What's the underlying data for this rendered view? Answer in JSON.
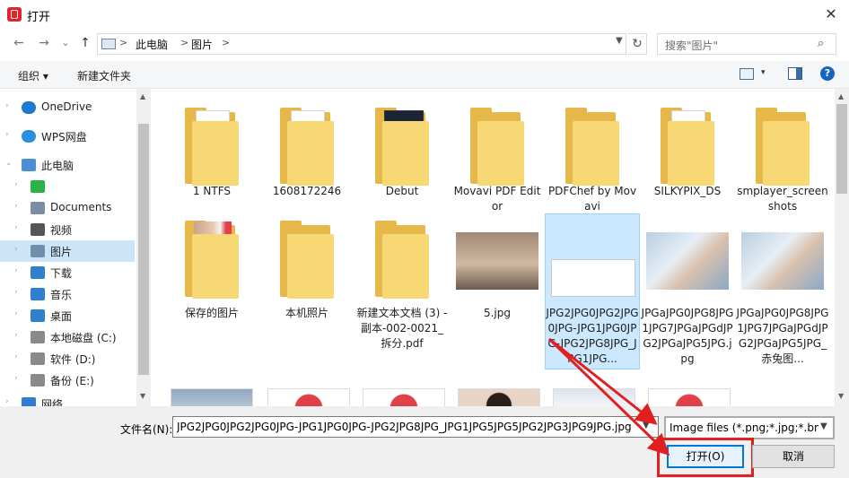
{
  "window": {
    "title": "打开",
    "close": "✕"
  },
  "nav": {
    "back": "←",
    "forward": "→",
    "recent": "⌄",
    "up": "↑"
  },
  "address": {
    "crumbs": [
      "此电脑",
      "图片"
    ],
    "separator": ">",
    "refresh": "↻"
  },
  "search": {
    "placeholder": "搜索\"图片\""
  },
  "toolbar": {
    "organize": "组织 ▾",
    "new_folder": "新建文件夹",
    "view_drop": "▾",
    "help": "?"
  },
  "sidebar": {
    "items": [
      {
        "label": "OneDrive",
        "icon": "cloud-icon"
      },
      {
        "label": "WPS网盘",
        "icon": "wps-cloud-icon"
      },
      {
        "label": "此电脑",
        "icon": "computer-icon"
      },
      {
        "label": "",
        "icon": "wechat-icon"
      },
      {
        "label": "Documents",
        "icon": "documents-icon"
      },
      {
        "label": "视频",
        "icon": "video-icon"
      },
      {
        "label": "图片",
        "icon": "pictures-icon"
      },
      {
        "label": "下载",
        "icon": "download-icon"
      },
      {
        "label": "音乐",
        "icon": "music-icon"
      },
      {
        "label": "桌面",
        "icon": "desktop-icon"
      },
      {
        "label": "本地磁盘 (C:)",
        "icon": "drive-icon"
      },
      {
        "label": "软件 (D:)",
        "icon": "drive-icon"
      },
      {
        "label": "备份 (E:)",
        "icon": "drive-icon"
      },
      {
        "label": "网络",
        "icon": "network-icon"
      }
    ]
  },
  "files": [
    {
      "label": "1 NTFS",
      "type": "folder"
    },
    {
      "label": "1608172246",
      "type": "folder"
    },
    {
      "label": "Debut",
      "type": "folder"
    },
    {
      "label": "Movavi PDF Editor",
      "type": "folder"
    },
    {
      "label": "PDFChef by Movavi",
      "type": "folder"
    },
    {
      "label": "SILKYPIX_DS",
      "type": "folder"
    },
    {
      "label": "smplayer_screenshots",
      "type": "folder"
    },
    {
      "label": "保存的图片",
      "type": "folder"
    },
    {
      "label": "本机照片",
      "type": "folder"
    },
    {
      "label": "新建文本文档 (3) - 副本-002-0021_拆分.pdf",
      "type": "folder"
    },
    {
      "label": "5.jpg",
      "type": "image"
    },
    {
      "label": "JPG2JPG0JPG2JPG0JPG-JPG1JPG0JPG-JPG2JPG8JPG_JPG1JPG...",
      "type": "image"
    },
    {
      "label": "JPGaJPG0JPG8JPG1JPG7JPGaJPGdJPG2JPGaJPG5JPG.jpg",
      "type": "image"
    },
    {
      "label": "JPGaJPG0JPG8JPG1JPG7JPGaJPGdJPG2JPGaJPG5JPG_赤兔图...",
      "type": "image"
    }
  ],
  "filename": {
    "label": "文件名(N):",
    "value": "JPG2JPG0JPG2JPG0JPG-JPG1JPG0JPG-JPG2JPG8JPG_JPG1JPG5JPG5JPG2JPG3JPG9JPG.jpg"
  },
  "filter": {
    "value": "Image files (*.png;*.jpg;*.bm"
  },
  "buttons": {
    "open": "打开(O)",
    "cancel": "取消"
  },
  "colors": {
    "accent": "#0078d7",
    "selection": "#cce8ff",
    "annotation": "#e02020",
    "folder": "#f8d775"
  }
}
